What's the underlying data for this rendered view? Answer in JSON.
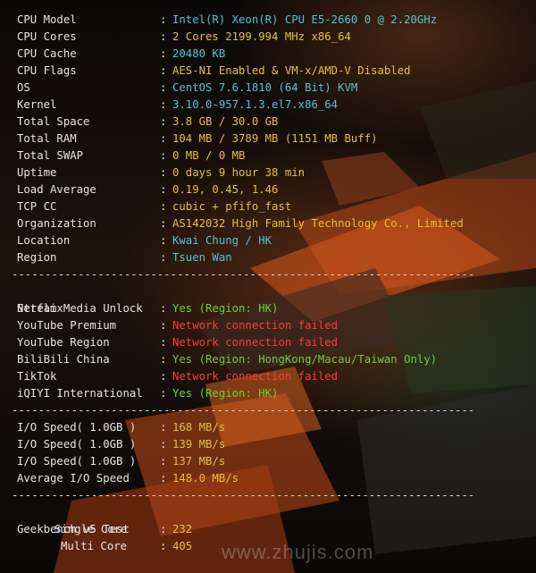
{
  "system": [
    {
      "label": "CPU Model",
      "value": "Intel(R) Xeon(R) CPU E5-2660 0 @ 2.20GHz",
      "color": "cyan"
    },
    {
      "label": "CPU Cores",
      "value": "2 Cores 2199.994 MHz x86_64",
      "color": "yellow"
    },
    {
      "label": "CPU Cache",
      "value": "20480 KB",
      "color": "cyan"
    },
    {
      "label": "CPU Flags",
      "value": "AES-NI Enabled & VM-x/AMD-V Disabled",
      "color": "yellow"
    },
    {
      "label": "OS",
      "value": "CentOS 7.6.1810 (64 Bit) KVM",
      "color": "cyan"
    },
    {
      "label": "Kernel",
      "value": "3.10.0-957.1.3.el7.x86_64",
      "color": "cyan"
    },
    {
      "label": "Total Space",
      "value": "3.8 GB / 30.0 GB",
      "color": "yellow"
    },
    {
      "label": "Total RAM",
      "value": "104 MB / 3789 MB (1151 MB Buff)",
      "color": "yellow"
    },
    {
      "label": "Total SWAP",
      "value": "0 MB / 0 MB",
      "color": "yellow"
    },
    {
      "label": "Uptime",
      "value": "0 days 9 hour 38 min",
      "color": "yellow"
    },
    {
      "label": "Load Average",
      "value": "0.19, 0.45, 1.46",
      "color": "yellow"
    },
    {
      "label": "TCP CC",
      "value": "cubic + pfifo_fast",
      "color": "yellow"
    },
    {
      "label": "Organization",
      "value": "AS142032 High Family Technology Co., Limited",
      "color": "yellow"
    },
    {
      "label": "Location",
      "value": "Kwai Chung / HK",
      "color": "cyan"
    },
    {
      "label": "Region",
      "value": "Tsuen Wan",
      "color": "cyan"
    }
  ],
  "stream": {
    "header": "Stream Media Unlock",
    "items": [
      {
        "label": "Netflix",
        "value": "Yes (Region: HK)",
        "color": "green"
      },
      {
        "label": "YouTube Premium",
        "value": "Network connection failed",
        "color": "red"
      },
      {
        "label": "YouTube Region",
        "value": "Network connection failed",
        "color": "red"
      },
      {
        "label": "BiliBili China",
        "value": "Yes (Region: HongKong/Macau/Taiwan Only)",
        "color": "green"
      },
      {
        "label": "TikTok",
        "value": "Network connection failed",
        "color": "red"
      },
      {
        "label": "iQIYI International",
        "value": "Yes (Region: HK)",
        "color": "green"
      }
    ]
  },
  "io": [
    {
      "label": "I/O Speed( 1.0GB )",
      "value": "168 MB/s",
      "color": "yellow"
    },
    {
      "label": "I/O Speed( 1.0GB )",
      "value": "139 MB/s",
      "color": "yellow"
    },
    {
      "label": "I/O Speed( 1.0GB )",
      "value": "137 MB/s",
      "color": "yellow"
    },
    {
      "label": "Average I/O Speed",
      "value": "148.0 MB/s",
      "color": "yellow"
    }
  ],
  "geekbench": {
    "header": "Geekbench v5 Test",
    "items": [
      {
        "label": "Single Core",
        "value": "232",
        "color": "yellow"
      },
      {
        "label": "Multi Core",
        "value": "405",
        "color": "yellow"
      }
    ]
  },
  "separator": ":",
  "divider": "----------------------------------------------------------------------",
  "watermark": "www.zhujis.com"
}
